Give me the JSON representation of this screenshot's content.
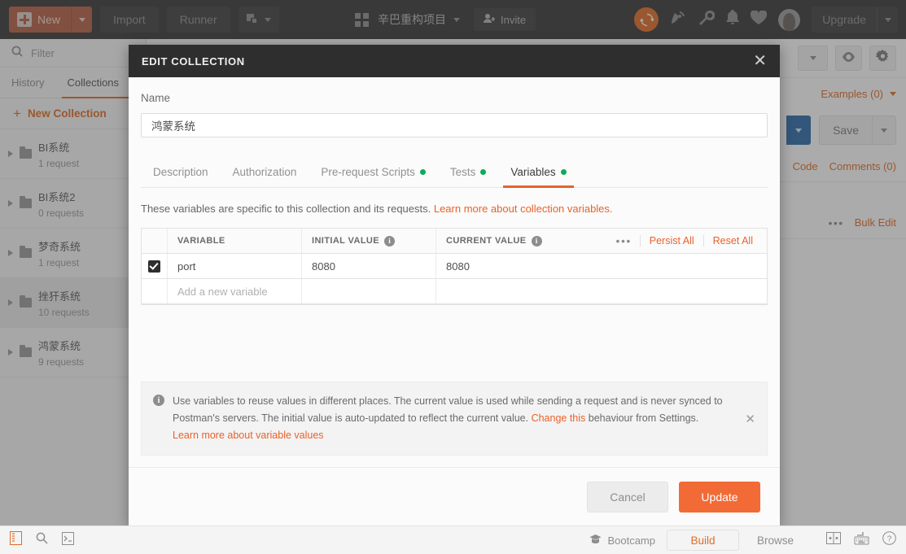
{
  "topbar": {
    "new_label": "New",
    "import_label": "Import",
    "runner_label": "Runner",
    "new_tab_icon": "new-tab-icon",
    "workspace_name": "辛巴重构项目",
    "invite_label": "Invite",
    "sync_icon": "sync-icon",
    "satellite_icon": "satellite-icon",
    "wrench_icon": "wrench-icon",
    "bell_icon": "bell-icon",
    "heart_icon": "heart-icon",
    "avatar_icon": "avatar",
    "upgrade_label": "Upgrade"
  },
  "sidebar": {
    "filter_placeholder": "Filter",
    "search_icon": "search-icon",
    "tabs": [
      {
        "label": "History",
        "active": false
      },
      {
        "label": "Collections",
        "active": true
      }
    ],
    "new_collection_label": "New Collection",
    "collections": [
      {
        "name": "BI系统",
        "meta": "1 request",
        "selected": false
      },
      {
        "name": "BI系统2",
        "meta": "0 requests",
        "selected": false
      },
      {
        "name": "梦奇系统",
        "meta": "1 request",
        "selected": false
      },
      {
        "name": "挫犴系统",
        "meta": "10 requests",
        "selected": true
      },
      {
        "name": "鸿蒙系统",
        "meta": "9 requests",
        "selected": false
      }
    ]
  },
  "main": {
    "eye_icon": "eye-icon",
    "gear_icon": "gear-icon",
    "examples_label": "Examples (0)",
    "save_label": "Save",
    "code_label": "Code",
    "comments_label": "Comments (0)",
    "bulk_edit_label": "Bulk Edit",
    "more_icon": "more-horizontal-icon"
  },
  "modal": {
    "title": "EDIT COLLECTION",
    "close_icon": "close-icon",
    "name_label": "Name",
    "name_value": "鸿蒙系统",
    "tabs": [
      {
        "label": "Description",
        "dot": false,
        "active": false
      },
      {
        "label": "Authorization",
        "dot": false,
        "active": false
      },
      {
        "label": "Pre-request Scripts",
        "dot": true,
        "active": false
      },
      {
        "label": "Tests",
        "dot": true,
        "active": false
      },
      {
        "label": "Variables",
        "dot": true,
        "active": true
      }
    ],
    "hint_text": "These variables are specific to this collection and its requests. ",
    "hint_link": "Learn more about collection variables.",
    "table": {
      "columns": [
        "VARIABLE",
        "INITIAL VALUE",
        "CURRENT VALUE"
      ],
      "persist_all_label": "Persist All",
      "reset_all_label": "Reset All",
      "more_icon": "more-horizontal-icon",
      "rows": [
        {
          "checked": true,
          "variable": "port",
          "initial_value": "8080",
          "current_value": "8080"
        }
      ],
      "add_row_placeholder": "Add a new variable"
    },
    "notice": {
      "icon": "info-icon",
      "text_1": "Use variables to reuse values in different places. The current value is used while sending a request and is never synced to Postman's servers. The initial value is auto-updated to reflect the current value. ",
      "link_1": "Change this",
      "text_2": " behaviour from Settings.",
      "link_2": "Learn more about variable values",
      "close_icon": "close-icon"
    },
    "cancel_label": "Cancel",
    "update_label": "Update"
  },
  "statusbar": {
    "sidebar_toggle_icon": "sidebar-toggle-icon",
    "find_icon": "search-icon",
    "console_icon": "console-icon",
    "bootcamp_label": "Bootcamp",
    "bootcamp_icon": "bootcamp-icon",
    "build_label": "Build",
    "browse_label": "Browse",
    "two_pane_icon": "two-pane-layout-icon",
    "keyboard_icon": "keyboard-shortcuts-icon",
    "help_icon": "help-icon"
  },
  "colors": {
    "accent_orange": "#e9622b",
    "dot_green": "#0cab5a",
    "topbar_dark": "#373737",
    "send_blue": "#2c6ca8"
  }
}
